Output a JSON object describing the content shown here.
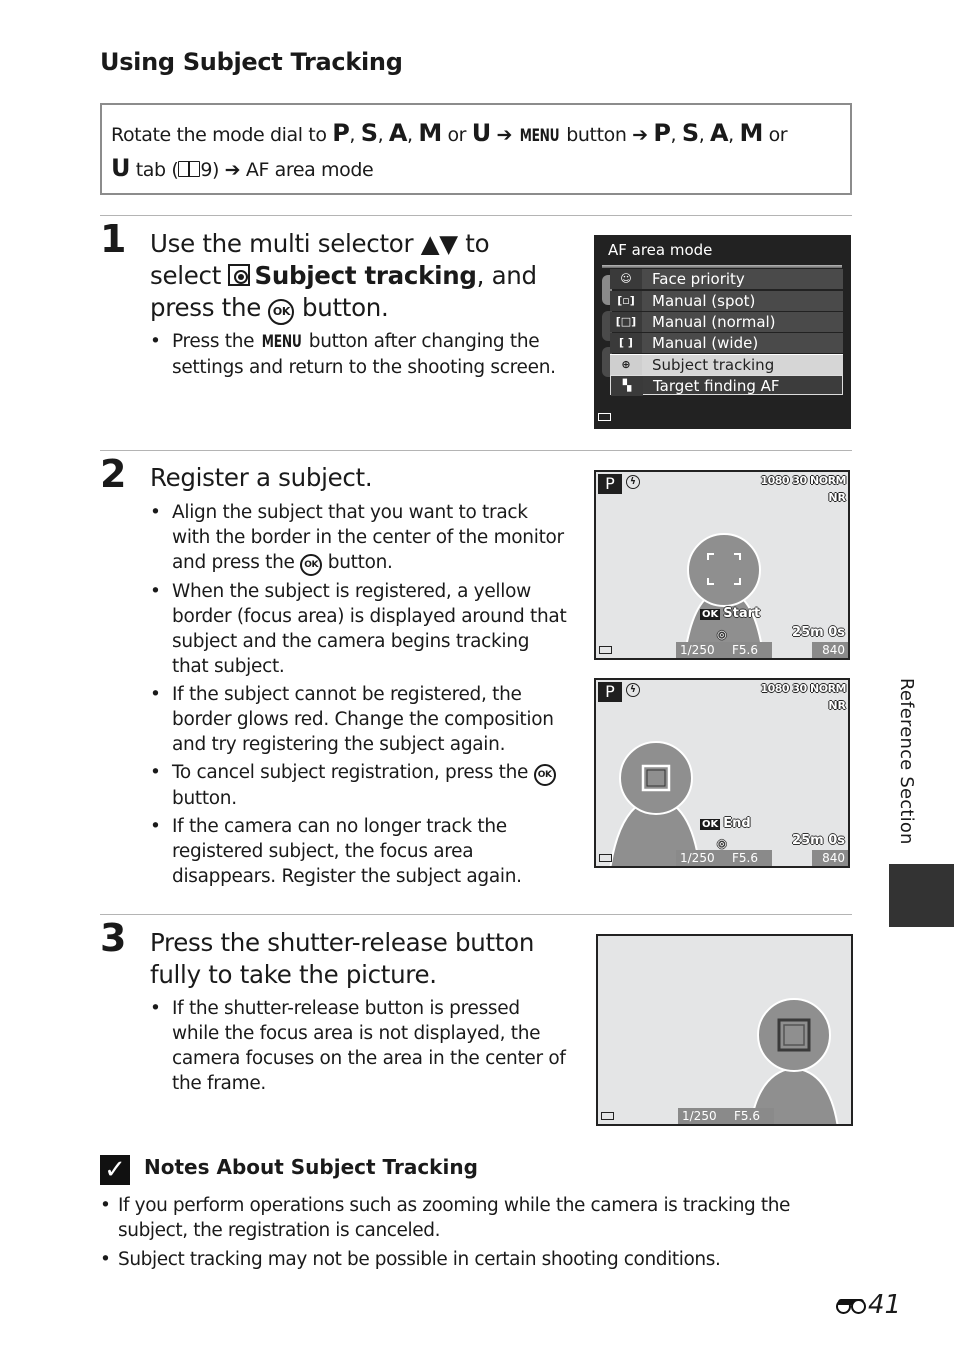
{
  "page": {
    "title": "Using Subject Tracking",
    "side_tab": "Reference Section",
    "page_number_prefix_icon": "binoculars-e-icon",
    "page_number": "41"
  },
  "route": {
    "line1": [
      "Rotate the mode dial to ",
      "P",
      ", ",
      "S",
      ", ",
      "A",
      ", ",
      "M",
      " or ",
      "U",
      " ➔ ",
      "MENU",
      " button ➔ ",
      "P",
      ", ",
      "S",
      ", ",
      "A",
      ", ",
      "M",
      " or"
    ],
    "line2_modes": "U",
    "line2_text_a": " tab (",
    "line2_ref_icon": "book-icon",
    "line2_ref": "9) ➔ AF area mode"
  },
  "steps": [
    {
      "number": "1",
      "heading_a": "Use the multi selector ▲▼ to",
      "heading_b": "select ",
      "heading_bold": "Subject tracking",
      "heading_c": ", and",
      "heading_d_a": "press the ",
      "heading_d_b": " button.",
      "bullets": [
        {
          "a": "Press the ",
          "menu": "MENU",
          "b": " button after changing the settings and return to the shooting screen."
        }
      ]
    },
    {
      "number": "2",
      "heading": "Register a subject.",
      "bullets": [
        {
          "a": "Align the subject that you want to track with the border in the center of the monitor and press the ",
          "b": " button."
        },
        {
          "text": "When the subject is registered, a yellow border (focus area) is displayed around that subject and the camera begins tracking that subject."
        },
        {
          "text": "If the subject cannot be registered, the border glows red. Change the composition and try registering the subject again."
        },
        {
          "a": "To cancel subject registration, press the ",
          "b": " button."
        },
        {
          "text": "If the camera can no longer track the registered subject, the focus area disappears. Register the subject again."
        }
      ]
    },
    {
      "number": "3",
      "heading_a": "Press the shutter-release button",
      "heading_b": "fully to take the picture.",
      "bullets": [
        {
          "text": "If the shutter-release button is pressed while the focus area is not displayed, the camera focuses on the area in the center of the frame."
        }
      ]
    }
  ],
  "ok_glyph": "OK",
  "menu_screen": {
    "title": "AF area mode",
    "items": [
      {
        "icon": "face-priority-icon",
        "glyph": "☺",
        "label": "Face priority"
      },
      {
        "icon": "manual-spot-icon",
        "glyph": "[▫]",
        "label": "Manual (spot)"
      },
      {
        "icon": "manual-normal-icon",
        "glyph": "[□]",
        "label": "Manual (normal)"
      },
      {
        "icon": "manual-wide-icon",
        "glyph": "[ ]",
        "label": "Manual (wide)"
      },
      {
        "icon": "subject-tracking-icon",
        "glyph": "⊕",
        "label": "Subject tracking",
        "selected": true
      },
      {
        "icon": "target-finding-af-icon",
        "glyph": "▚",
        "label": "Target finding AF"
      }
    ]
  },
  "shoot_screens": [
    {
      "mode": "P",
      "top_info": "1080 30 NORM",
      "top_info2": "NR",
      "action_ok": "OK",
      "action": "Start",
      "time_left": "25m 0s",
      "shutter": "1/250",
      "aperture": "F5.6",
      "count": "840"
    },
    {
      "mode": "P",
      "top_info": "1080 30 NORM",
      "top_info2": "NR",
      "action_ok": "OK",
      "action": "End",
      "time_left": "25m 0s",
      "shutter": "1/250",
      "aperture": "F5.6",
      "count": "840"
    },
    {
      "shutter": "1/250",
      "aperture": "F5.6"
    }
  ],
  "notes": {
    "heading": "Notes About Subject Tracking",
    "check_glyph": "✓",
    "items": [
      "If you perform operations such as zooming while the camera is tracking the subject, the registration is canceled.",
      "Subject tracking may not be possible in certain shooting conditions."
    ]
  }
}
